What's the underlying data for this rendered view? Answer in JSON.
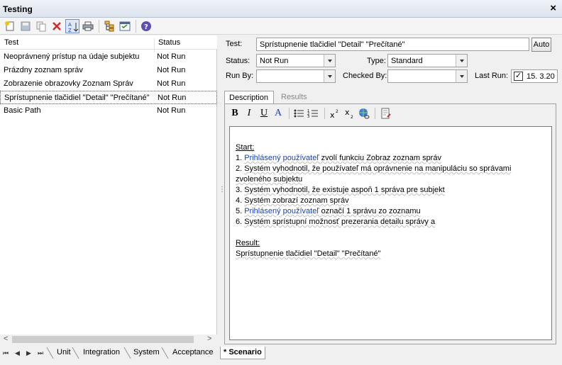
{
  "window": {
    "title": "Testing",
    "close_glyph": "×"
  },
  "toolbar": {
    "icons": [
      "new-icon",
      "save-icon",
      "copy-icon",
      "delete-icon",
      "sort-az-icon",
      "print-icon",
      "hierarchy-icon",
      "properties-icon",
      "help-icon"
    ]
  },
  "tests_list": {
    "columns": [
      "Test",
      "Status"
    ],
    "rows": [
      {
        "name": "Neoprávnený prístup na údaje subjektu",
        "status": "Not Run"
      },
      {
        "name": "Prázdny zoznam správ",
        "status": "Not Run"
      },
      {
        "name": "Zobrazenie obrazovky Zoznam Správ",
        "status": "Not Run"
      },
      {
        "name": "Sprístupnenie tlačidiel \"Detail\" \"Prečítané\"",
        "status": "Not Run",
        "selected": true
      },
      {
        "name": "Basic Path",
        "status": "Not Run"
      }
    ]
  },
  "form": {
    "test_label": "Test:",
    "test_value": "Sprístupnenie tlačidiel \"Detail\" \"Prečítané\"",
    "auto_button": "Auto",
    "status_label": "Status:",
    "status_value": "Not Run",
    "type_label": "Type:",
    "type_value": "Standard",
    "run_by_label": "Run By:",
    "run_by_value": "",
    "checked_by_label": "Checked By:",
    "checked_by_value": "",
    "last_run_label": "Last Run:",
    "last_run_checked": "✓",
    "last_run_value": "15.  3.20"
  },
  "detail_tabs": [
    "Description",
    "Results"
  ],
  "format_toolbar": [
    "B",
    "I",
    "U",
    "A"
  ],
  "description": {
    "start_label": "Start:",
    "steps": [
      {
        "num": "1. ",
        "actor": "Prihlásený používateľ",
        "text": " zvolí funkciu Zobraz zoznam správ"
      },
      {
        "num": "2. ",
        "text": "Systém vyhodnotil, že používateľ má oprávnenie na manipuláciu so správami"
      },
      {
        "num": "",
        "text": "zvoleného subjektu"
      },
      {
        "num": "3. ",
        "text": "Systém vyhodnotil, že existuje aspoň 1 správa pre subjekt"
      },
      {
        "num": "4. ",
        "text": "Systém zobrazí zoznam správ"
      },
      {
        "num": "5. ",
        "actor": "Prihlásený používateľ",
        "text": " označí 1 správu zo zoznamu"
      },
      {
        "num": "6. ",
        "text": "Systém sprístupní možnosť prezerania detailu správy a"
      }
    ],
    "result_label": "Result:",
    "result_text": "Sprístupnenie tlačidiel \"Detail\" \"Prečítané\""
  },
  "bottom_tabs": [
    "Unit",
    "Integration",
    "System",
    "Acceptance",
    "* Scenario"
  ],
  "nav": {
    "first": "⏮",
    "prev": "◀",
    "next": "▶",
    "last": "⏭"
  },
  "scroll": {
    "left": "<",
    "right": ">"
  },
  "colors": {
    "link": "#1a3fb0",
    "delete": "#d22a2a",
    "help": "#5b4fb3"
  }
}
